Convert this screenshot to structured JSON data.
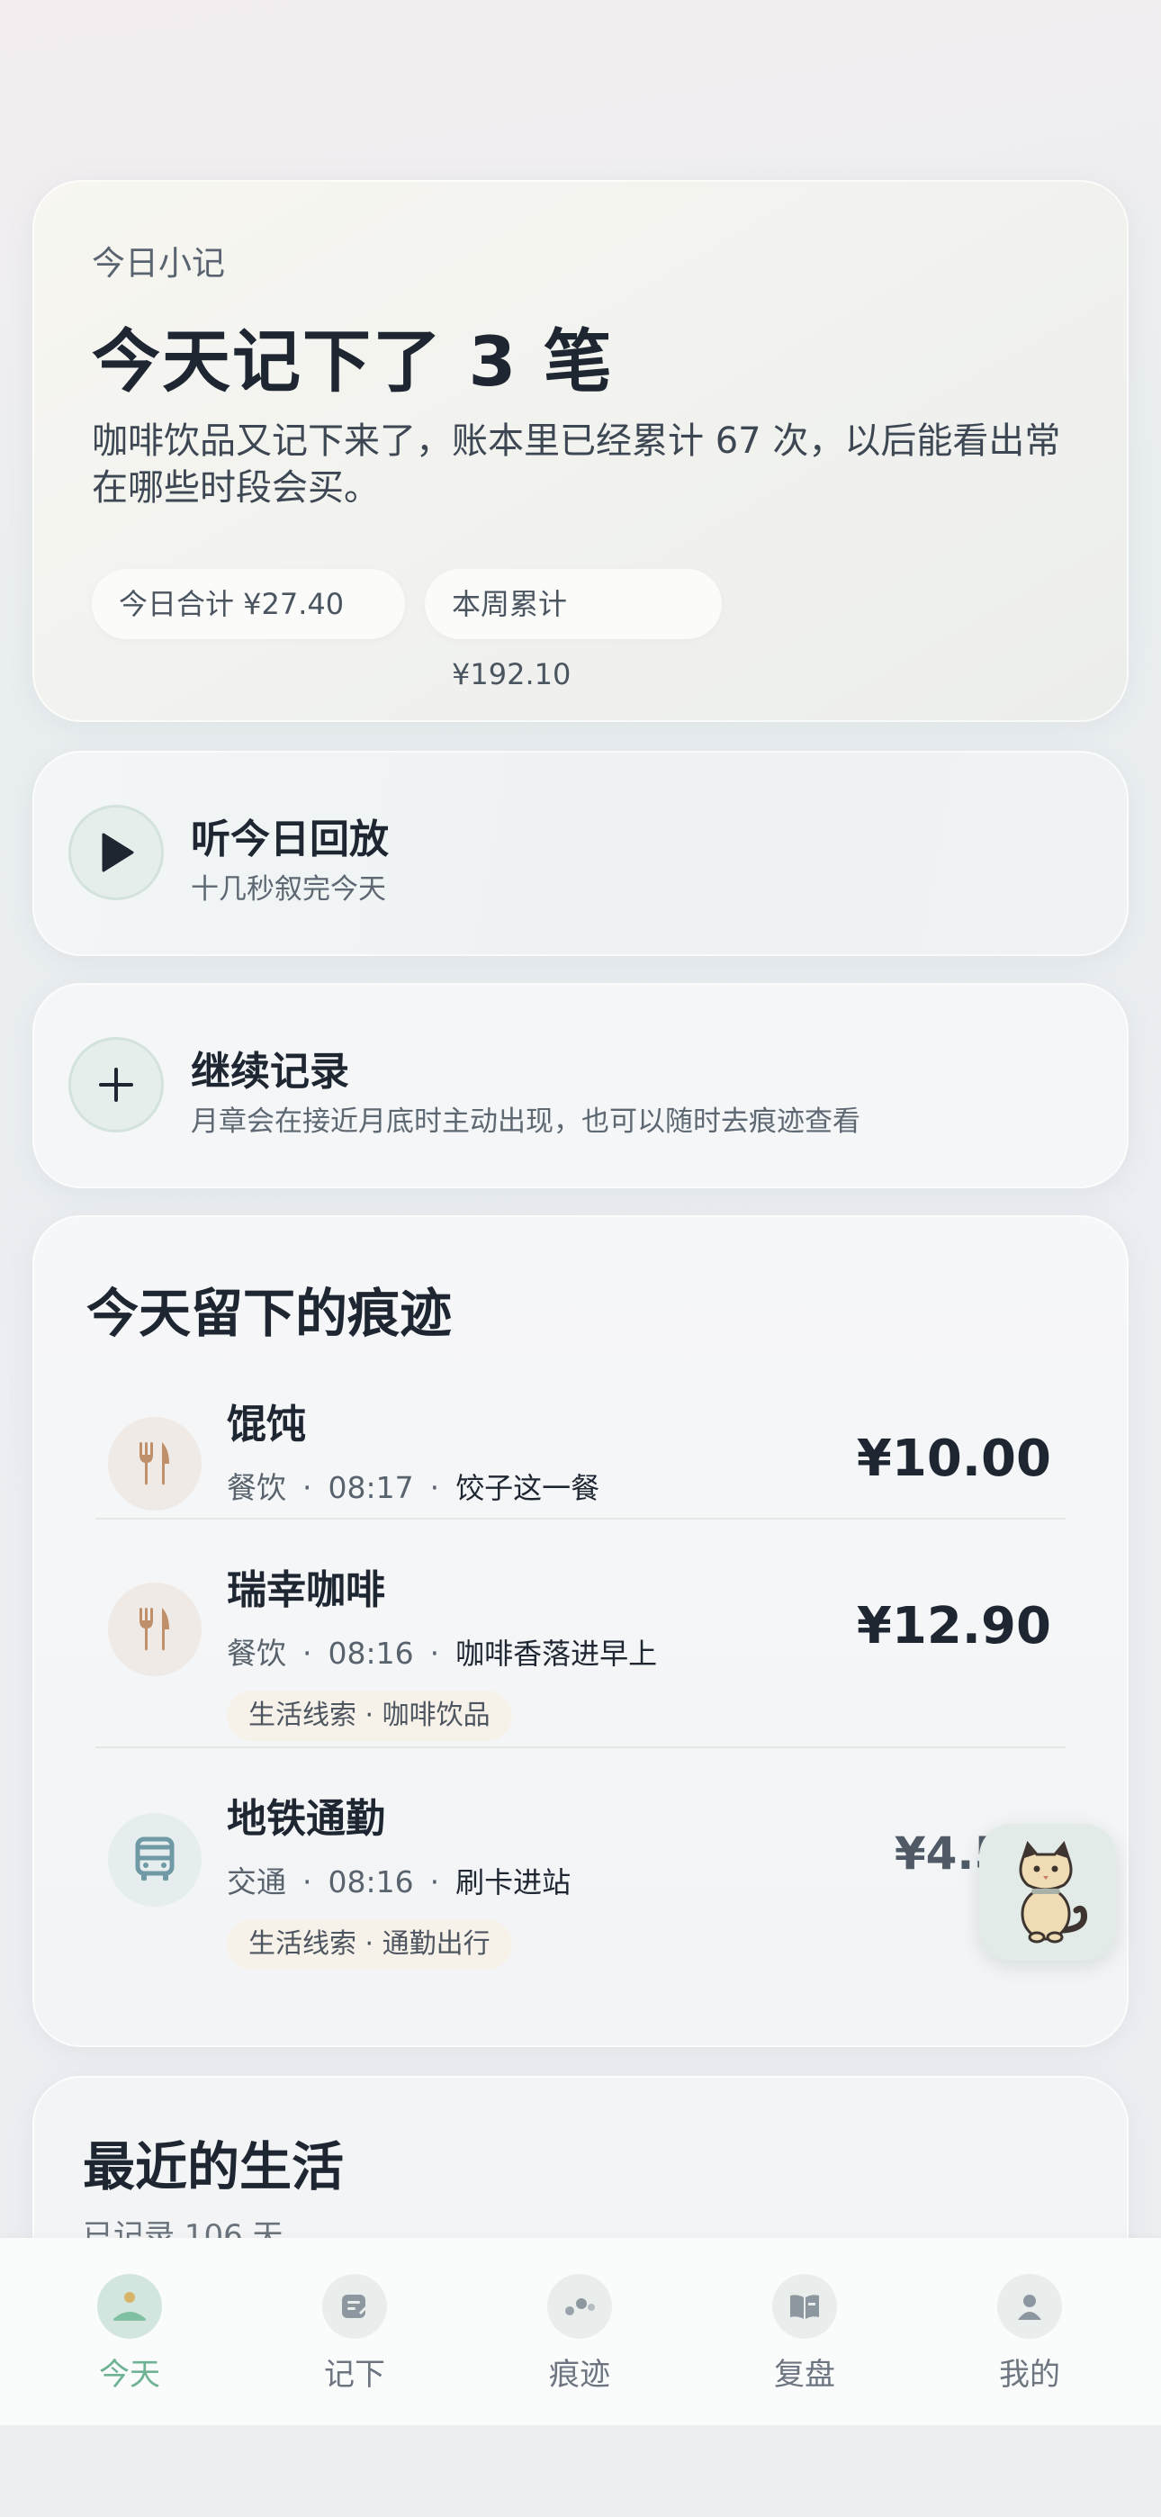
{
  "summary": {
    "eyebrow": "今日小记",
    "title": "今天记下了 3 笔",
    "description": "咖啡饮品又记下来了，账本里已经累计 67 次，以后能看出常在哪些时段会买。",
    "today_total": "今日合计 ¥27.40",
    "week_total": "本周累计 ¥192.10"
  },
  "replay": {
    "label": "听今日回放",
    "sub": "十几秒叙完今天",
    "icon": "play-icon"
  },
  "continue": {
    "label": "继续记录",
    "sub": "月章会在接近月底时主动出现，也可以随时去痕迹查看",
    "icon": "plus-icon"
  },
  "traces": {
    "title": "今天留下的痕迹",
    "items": [
      {
        "name": "馄饨",
        "category": "餐饮",
        "time": "08:17",
        "note": "饺子这一餐",
        "amount": "¥10.00",
        "tag": "",
        "icon": "utensils-icon"
      },
      {
        "name": "瑞幸咖啡",
        "category": "餐饮",
        "time": "08:16",
        "note": "咖啡香落进早上",
        "amount": "¥12.90",
        "tag": "生活线索 · 咖啡饮品",
        "icon": "utensils-icon"
      },
      {
        "name": "地铁通勤",
        "category": "交通",
        "time": "08:16",
        "note": "刷卡进站",
        "amount": "¥4.50",
        "tag": "生活线索 · 通勤出行",
        "icon": "bus-icon"
      }
    ],
    "separator": "·"
  },
  "recent": {
    "title": "最近的生活",
    "sub": "已记录 106 天"
  },
  "tabs": [
    {
      "label": "今天",
      "icon": "today-icon",
      "active": true
    },
    {
      "label": "记下",
      "icon": "note-icon",
      "active": false
    },
    {
      "label": "痕迹",
      "icon": "traces-icon",
      "active": false
    },
    {
      "label": "复盘",
      "icon": "book-icon",
      "active": false
    },
    {
      "label": "我的",
      "icon": "profile-icon",
      "active": false
    }
  ],
  "colors": {
    "accent": "#6fb394",
    "text": "#1e2632",
    "food_icon": "#c0906a",
    "bus_icon": "#6f9aa5"
  }
}
